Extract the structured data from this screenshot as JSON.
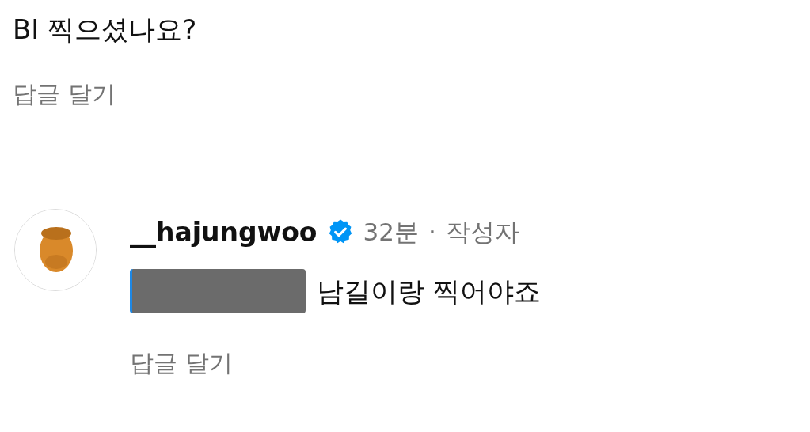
{
  "parent_comment": {
    "text": "BI 찍으셨나요?",
    "reply_link": "답글 달기"
  },
  "reply": {
    "username": "__hajungwoo",
    "verified": true,
    "time": "32분",
    "separator": "·",
    "author_tag": "작성자",
    "mention_redacted": true,
    "text": "남길이랑 찍어야죠",
    "reply_link": "답글 달기"
  }
}
